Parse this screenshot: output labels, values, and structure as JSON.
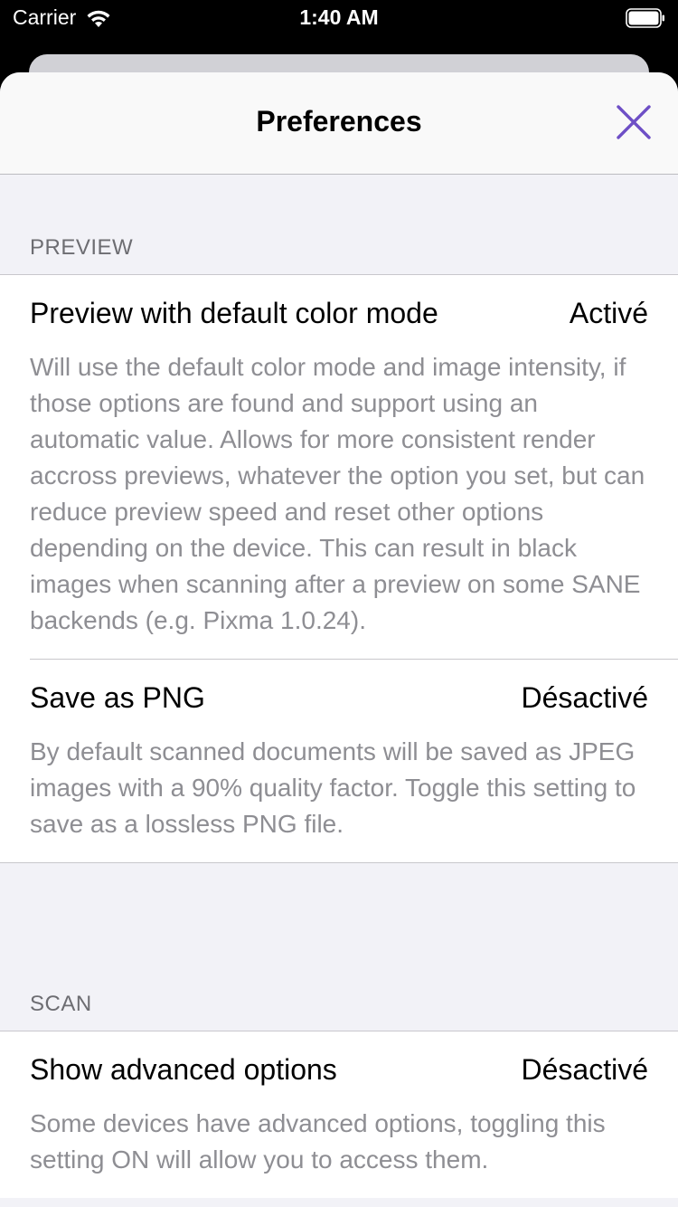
{
  "status_bar": {
    "carrier": "Carrier",
    "time": "1:40 AM"
  },
  "sheet": {
    "title": "Preferences",
    "close_icon": "close-icon",
    "accent_color": "#6e4fc6"
  },
  "sections": {
    "preview": {
      "header": "PREVIEW",
      "items": [
        {
          "title": "Preview with default color mode",
          "value": "Activé",
          "description": "Will use the default color mode and image intensity, if those options are found and support using an automatic value. Allows for more consistent render accross previews, whatever the option you set, but can reduce preview speed and reset other options depending on the device. This can result in black images when scanning after a preview on some SANE backends (e.g. Pixma 1.0.24)."
        },
        {
          "title": "Save as PNG",
          "value": "Désactivé",
          "description": "By default scanned documents will be saved as JPEG images with a 90% quality factor. Toggle this setting to save as a lossless PNG file."
        }
      ]
    },
    "scan": {
      "header": "SCAN",
      "items": [
        {
          "title": "Show advanced options",
          "value": "Désactivé",
          "description": "Some devices have advanced options, toggling this setting ON will allow you to access them."
        }
      ]
    }
  }
}
